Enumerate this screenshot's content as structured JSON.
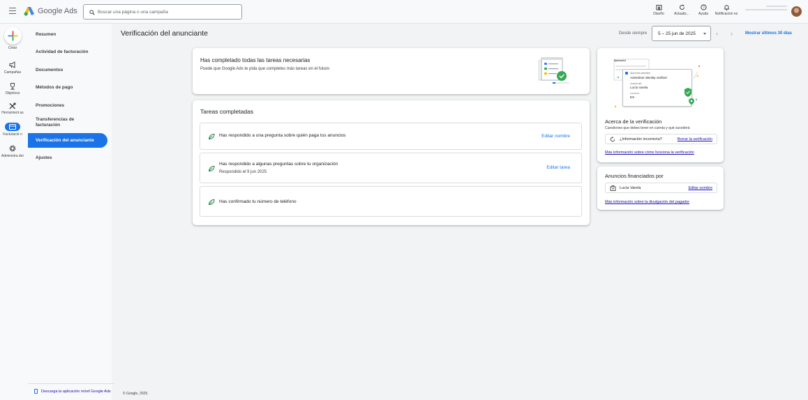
{
  "app": {
    "brand": "Google Ads",
    "search_placeholder": "Buscar una página o una campaña",
    "tools": [
      {
        "icon": "design-icon",
        "label": "Diseño"
      },
      {
        "icon": "refresh-icon",
        "label": "Actualiz..."
      },
      {
        "icon": "help-icon",
        "label": "Ayuda"
      },
      {
        "icon": "bell-icon",
        "label": "Notificacion es"
      }
    ]
  },
  "rail": {
    "items": [
      {
        "icon": "plus-icon",
        "label": "Crear"
      },
      {
        "icon": "megaphone-icon",
        "label": "Campañas"
      },
      {
        "icon": "trophy-icon",
        "label": "Objetivos"
      },
      {
        "icon": "tools-icon",
        "label": "Herramient as"
      },
      {
        "icon": "billing-icon",
        "label": "Facturació n"
      },
      {
        "icon": "gear-icon",
        "label": "Administra dor"
      }
    ],
    "active_color": "#1a73e8"
  },
  "nav": {
    "items": [
      "Resumen",
      "Actividad de facturación",
      "Documentos",
      "Métodos de pago",
      "Promociones",
      "Transferencias de facturación",
      "Verificación del anunciante",
      "Ajustes"
    ],
    "active_index": 6,
    "footer": "Descarga la aplicación móvil Google Ads"
  },
  "footer": {
    "copyright": "© Google, 2025."
  },
  "header": {
    "title": "Verificación del anunciante",
    "range_label": "Desde siempre",
    "range_value": "5 – 25 jun de 2025",
    "last30": "Mostrar últimos 30 días"
  },
  "completed_card": {
    "title": "Has completado todas las tareas necesarias",
    "subtitle": "Puede que Google Ads te pida que completes más tareas en el futuro"
  },
  "tasks_card": {
    "title": "Tareas completadas",
    "tasks": [
      {
        "text": "Has respondido a una pregunta sobre quién paga tus anuncios",
        "sub": "",
        "action": "Editar nombre"
      },
      {
        "text": "Has respondido a algunas preguntas sobre tu organización",
        "sub": "Respondido el 9 jun 2025",
        "action": "Editar tarea"
      },
      {
        "text": "Has confirmado tu número de teléfono",
        "sub": "",
        "action": ""
      }
    ]
  },
  "about_card": {
    "illustration": {
      "sponsored": "Sponsored",
      "about": "About this advertiser",
      "verified": "Advertiser identity verified",
      "advertiser_label": "ADVERTISER",
      "advertiser": "Lucía Varela",
      "location_label": "LOCATION",
      "location": "ES"
    },
    "title": "Acerca de la verificación",
    "subtitle": "Cuestiones que debes tener en cuenta y qué sucederá",
    "incorrect": "¿Información incorrecta?",
    "delete_link": "Borrar la verificación",
    "more_link": "Más información sobre cómo funciona la verificación"
  },
  "ads_card": {
    "title": "Anuncios financiados por",
    "payer": "Lucía Varela",
    "edit": "Editar nombre",
    "more_link": "Más información sobre la divulgación del pagador"
  }
}
